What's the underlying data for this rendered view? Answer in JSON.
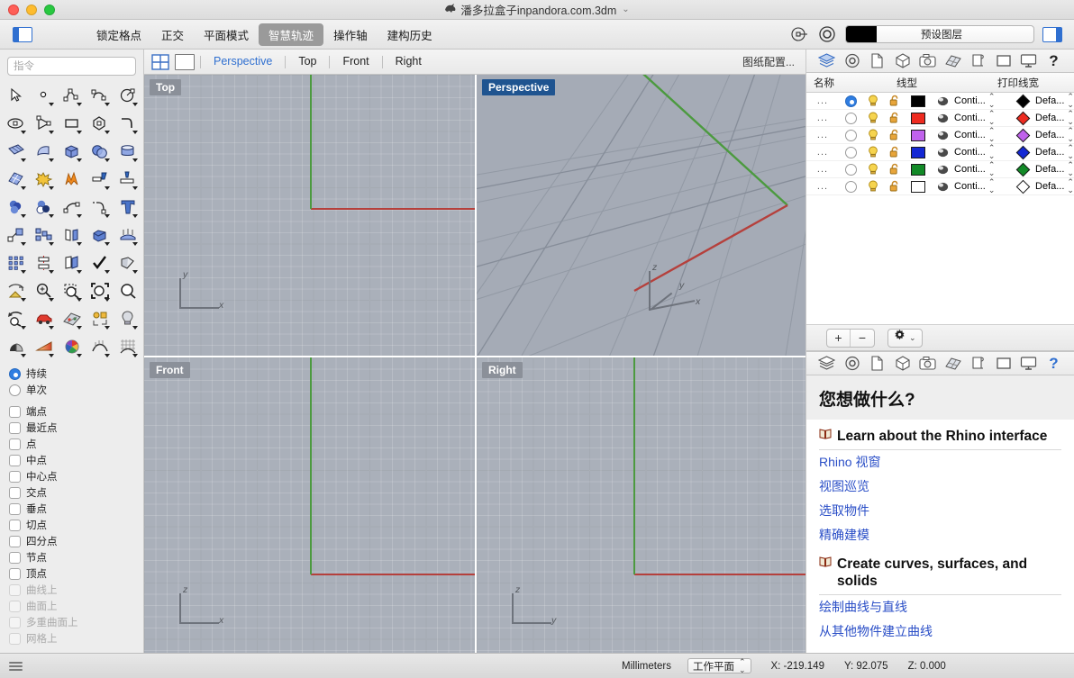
{
  "window": {
    "title": "潘多拉盒子inpandora.com.3dm",
    "rhino_icon": "rhino-head-icon",
    "chevron": "⌄"
  },
  "toolbar": {
    "left_panel_toggle": "left-panel-toggle-icon",
    "right_panel_toggle": "right-panel-toggle-icon",
    "items": [
      {
        "label": "锁定格点",
        "active": false
      },
      {
        "label": "正交",
        "active": false
      },
      {
        "label": "平面模式",
        "active": false
      },
      {
        "label": "智慧轨迹",
        "active": true
      },
      {
        "label": "操作轴",
        "active": false
      },
      {
        "label": "建构历史",
        "active": false
      }
    ],
    "icons": [
      {
        "name": "gumball-target-icon"
      },
      {
        "name": "record-circle-icon"
      }
    ],
    "layer_selector": {
      "color": "#000000",
      "label": "预设图层"
    }
  },
  "sidebar": {
    "command": {
      "placeholder": "指令",
      "value": ""
    },
    "tool_rows": [
      [
        "select-arrow-icon",
        "point-icon",
        "polyline-icon",
        "curve-icon",
        "circle-icon"
      ],
      [
        "ellipse-icon",
        "arc-icon",
        "rectangle-icon",
        "polygon-icon",
        "fillet-curve-icon"
      ],
      [
        "surface-from-points-icon",
        "sweep-surface-icon",
        "box-icon",
        "sphere-boolean-icon",
        "cylinder-icon"
      ],
      [
        "mesh-from-surface-icon",
        "explode-icon",
        "blast-icon",
        "trim-icon",
        "split-icon"
      ],
      [
        "boolean-union-icon",
        "boolean-difference-icon",
        "offset-curve-icon",
        "blend-curve-icon",
        "text-tool-icon"
      ],
      [
        "scale-icon",
        "array-icon",
        "mirror-icon",
        "extrude-solid-icon",
        "loft-icon"
      ],
      [
        "grid-array-icon",
        "align-icon",
        "copy-icon",
        "check-icon",
        "cap-icon"
      ],
      [
        "rotate-view-icon",
        "zoom-in-icon",
        "zoom-window-icon",
        "zoom-extents-icon",
        "zoom-selected-icon"
      ],
      [
        "undo-view-icon",
        "car-render-icon",
        "render-preview-icon",
        "layer-state-icon",
        "light-bulb-icon"
      ],
      [
        "shadow-icon",
        "gradient-icon",
        "color-wheel-icon",
        "curvature-icon",
        "mesh-grid-icon"
      ]
    ],
    "osnap_modes": [
      {
        "label": "持续",
        "type": "radio",
        "checked": true
      },
      {
        "label": "单次",
        "type": "radio",
        "checked": false
      }
    ],
    "osnap_items": [
      {
        "label": "端点",
        "checked": false,
        "disabled": false
      },
      {
        "label": "最近点",
        "checked": false,
        "disabled": false
      },
      {
        "label": "点",
        "checked": false,
        "disabled": false
      },
      {
        "label": "中点",
        "checked": false,
        "disabled": false
      },
      {
        "label": "中心点",
        "checked": false,
        "disabled": false
      },
      {
        "label": "交点",
        "checked": false,
        "disabled": false
      },
      {
        "label": "垂点",
        "checked": false,
        "disabled": false
      },
      {
        "label": "切点",
        "checked": false,
        "disabled": false
      },
      {
        "label": "四分点",
        "checked": false,
        "disabled": false
      },
      {
        "label": "节点",
        "checked": false,
        "disabled": false
      },
      {
        "label": "顶点",
        "checked": false,
        "disabled": false
      },
      {
        "label": "曲线上",
        "checked": false,
        "disabled": true
      },
      {
        "label": "曲面上",
        "checked": false,
        "disabled": true
      },
      {
        "label": "多重曲面上",
        "checked": false,
        "disabled": true
      },
      {
        "label": "网格上",
        "checked": false,
        "disabled": true
      }
    ]
  },
  "viewport_tabs": {
    "layout_icon": "four-view-layout-icon",
    "single_icon": "single-view-layout-icon",
    "tabs": [
      {
        "label": "Perspective",
        "active": true
      },
      {
        "label": "Top",
        "active": false
      },
      {
        "label": "Front",
        "active": false
      },
      {
        "label": "Right",
        "active": false
      }
    ],
    "config_label": "图纸配置..."
  },
  "viewports": [
    {
      "name": "Top",
      "active": false,
      "axes": [
        "y",
        "x"
      ]
    },
    {
      "name": "Perspective",
      "active": true,
      "axes": [
        "z",
        "y",
        "x"
      ]
    },
    {
      "name": "Front",
      "active": false,
      "axes": [
        "z",
        "x"
      ]
    },
    {
      "name": "Right",
      "active": false,
      "axes": [
        "z",
        "y"
      ]
    }
  ],
  "layers_panel": {
    "tabs": [
      {
        "name": "layers-icon",
        "active": true
      },
      {
        "name": "target-icon",
        "active": false
      },
      {
        "name": "page-icon",
        "active": false
      },
      {
        "name": "cube-icon",
        "active": false
      },
      {
        "name": "camera-icon",
        "active": false
      },
      {
        "name": "materials-icon",
        "active": false
      },
      {
        "name": "named-views-icon",
        "active": false
      },
      {
        "name": "rectangle-icon",
        "active": false
      },
      {
        "name": "display-icon",
        "active": false
      },
      {
        "name": "help-icon",
        "active": false
      }
    ],
    "columns": {
      "name": "名称",
      "linetype": "线型",
      "print_width": "打印线宽"
    },
    "rows": [
      {
        "name": "...",
        "current": true,
        "visible": true,
        "locked": false,
        "color": "#000000",
        "linetype": "Conti...",
        "print_color": "#000000",
        "print_width": "Defa..."
      },
      {
        "name": "...",
        "current": false,
        "visible": true,
        "locked": false,
        "color": "#ee2b20",
        "linetype": "Conti...",
        "print_color": "#ee2b20",
        "print_width": "Defa..."
      },
      {
        "name": "...",
        "current": false,
        "visible": true,
        "locked": false,
        "color": "#c062ec",
        "linetype": "Conti...",
        "print_color": "#c062ec",
        "print_width": "Defa..."
      },
      {
        "name": "...",
        "current": false,
        "visible": true,
        "locked": false,
        "color": "#1428d4",
        "linetype": "Conti...",
        "print_color": "#1428d4",
        "print_width": "Defa..."
      },
      {
        "name": "...",
        "current": false,
        "visible": true,
        "locked": false,
        "color": "#128a27",
        "linetype": "Conti...",
        "print_color": "#128a27",
        "print_width": "Defa..."
      },
      {
        "name": "...",
        "current": false,
        "visible": true,
        "locked": false,
        "color": "#ffffff",
        "linetype": "Conti...",
        "print_color": "#ffffff",
        "print_width": "Defa..."
      }
    ],
    "footer": {
      "add_label": "+",
      "remove_label": "−",
      "gear_icon": "gear-icon",
      "gear_chevron": "⌄"
    }
  },
  "help_panel": {
    "tabs": [
      {
        "name": "layers-icon",
        "active": false
      },
      {
        "name": "target-icon",
        "active": false
      },
      {
        "name": "page-icon",
        "active": false
      },
      {
        "name": "cube-icon",
        "active": false
      },
      {
        "name": "camera-icon",
        "active": false
      },
      {
        "name": "materials-icon",
        "active": false
      },
      {
        "name": "named-views-icon",
        "active": false
      },
      {
        "name": "rectangle-icon",
        "active": false
      },
      {
        "name": "display-icon",
        "active": false
      },
      {
        "name": "help-icon",
        "active": true
      }
    ],
    "title": "您想做什么?",
    "sections": [
      {
        "heading": "Learn about the Rhino interface",
        "links": [
          "Rhino 视窗",
          "视图巡览",
          "选取物件",
          "精确建模"
        ]
      },
      {
        "heading": "Create curves, surfaces, and solids",
        "links": [
          "绘制曲线与直线",
          "从其他物件建立曲线"
        ]
      }
    ]
  },
  "statusbar": {
    "menu_icon": "hamburger-icon",
    "units": "Millimeters",
    "cplane_label": "工作平面",
    "x": "X: -219.149",
    "y": "Y: 92.075",
    "z": "Z: 0.000"
  },
  "colors": {
    "accent": "#2f6fd0",
    "viewport_bg": "#aab0ba",
    "axis_x": "#b5403c",
    "axis_y": "#4c9a3f",
    "active_tab_bg": "#1f5490"
  }
}
